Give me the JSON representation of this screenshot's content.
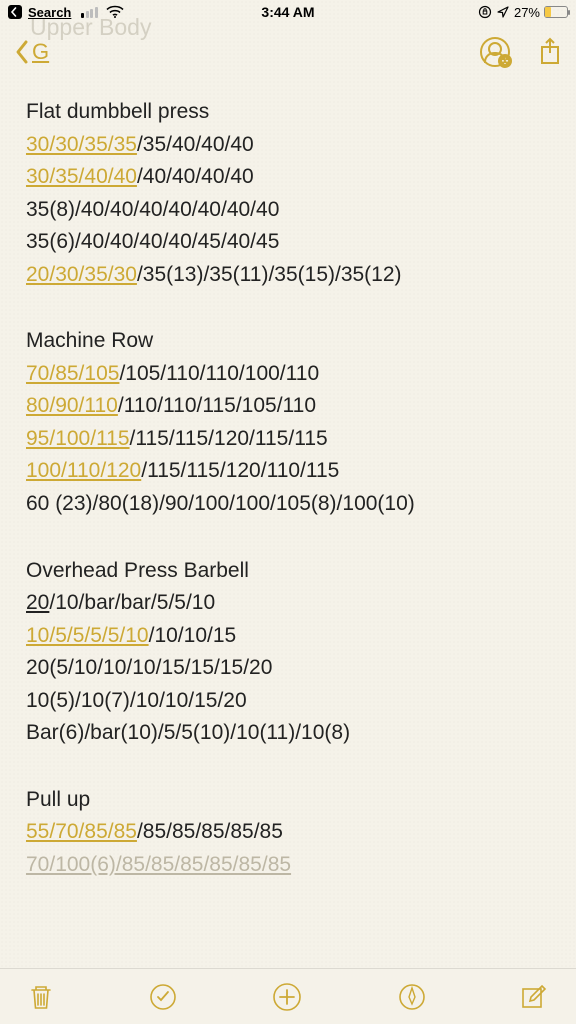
{
  "status": {
    "back_app": "Search",
    "time": "3:44 AM",
    "battery_text": "27%"
  },
  "nav": {
    "ghost_title": "Upper Body",
    "back_letter": "G"
  },
  "sections": [
    {
      "title": "Flat dumbbell press",
      "rows": [
        {
          "segments": [
            {
              "t": "30/30/35/35",
              "k": "link"
            },
            {
              "t": "/35/40/40/40",
              "k": "plain"
            }
          ]
        },
        {
          "segments": [
            {
              "t": "30/35/40/40",
              "k": "link"
            },
            {
              "t": "/40/40/40/40",
              "k": "plain"
            }
          ]
        },
        {
          "segments": [
            {
              "t": "35(8)/40/40/40/40/40/40/40",
              "k": "plain"
            }
          ]
        },
        {
          "segments": [
            {
              "t": "35(6)/40/40/40/40/45/40/45",
              "k": "plain"
            }
          ]
        },
        {
          "segments": [
            {
              "t": "20/30/35/30",
              "k": "link"
            },
            {
              "t": "/35(13)/35(11)/35(15)/35(12)",
              "k": "plain"
            }
          ]
        }
      ]
    },
    {
      "title": "Machine Row",
      "rows": [
        {
          "segments": [
            {
              "t": "70/85/105",
              "k": "link"
            },
            {
              "t": "/105/110/110/100/110",
              "k": "plain"
            }
          ]
        },
        {
          "segments": [
            {
              "t": "80/90/110",
              "k": "link"
            },
            {
              "t": "/110/110/115/105/110",
              "k": "plain"
            }
          ]
        },
        {
          "segments": [
            {
              "t": "95/100/115",
              "k": "link"
            },
            {
              "t": "/115/115/120/115/115",
              "k": "plain"
            }
          ]
        },
        {
          "segments": [
            {
              "t": "100/110/120",
              "k": "link"
            },
            {
              "t": "/115/115/120/110/115",
              "k": "plain"
            }
          ]
        },
        {
          "segments": [
            {
              "t": "60 (23)/80(18)/90/100/100/105(8)/100(10)",
              "k": "plain"
            }
          ]
        }
      ]
    },
    {
      "title": "Overhead Press Barbell",
      "rows": [
        {
          "segments": [
            {
              "t": "20",
              "k": "plain-underline"
            },
            {
              "t": "/10/bar/bar/5/5/10",
              "k": "plain"
            }
          ]
        },
        {
          "segments": [
            {
              "t": "10/5/5/5/5/10",
              "k": "link"
            },
            {
              "t": "/10/10/15",
              "k": "plain"
            }
          ]
        },
        {
          "segments": [
            {
              "t": "20(5/10/10/10/15/15/15/20",
              "k": "plain"
            }
          ]
        },
        {
          "segments": [
            {
              "t": "10(5)/10(7)/10/10/15/20",
              "k": "plain"
            }
          ]
        },
        {
          "segments": [
            {
              "t": "Bar(6)/bar(10)/5/5(10)/10(11)/10(8)",
              "k": "plain"
            }
          ]
        }
      ]
    },
    {
      "title": "Pull up",
      "rows": [
        {
          "segments": [
            {
              "t": "55/70/85/85",
              "k": "link"
            },
            {
              "t": "/85/85/85/85/85",
              "k": "plain"
            }
          ]
        },
        {
          "segments": [
            {
              "t": "70/100(6)/85/85/85/85/85/85",
              "k": "ghost"
            }
          ]
        }
      ]
    }
  ]
}
